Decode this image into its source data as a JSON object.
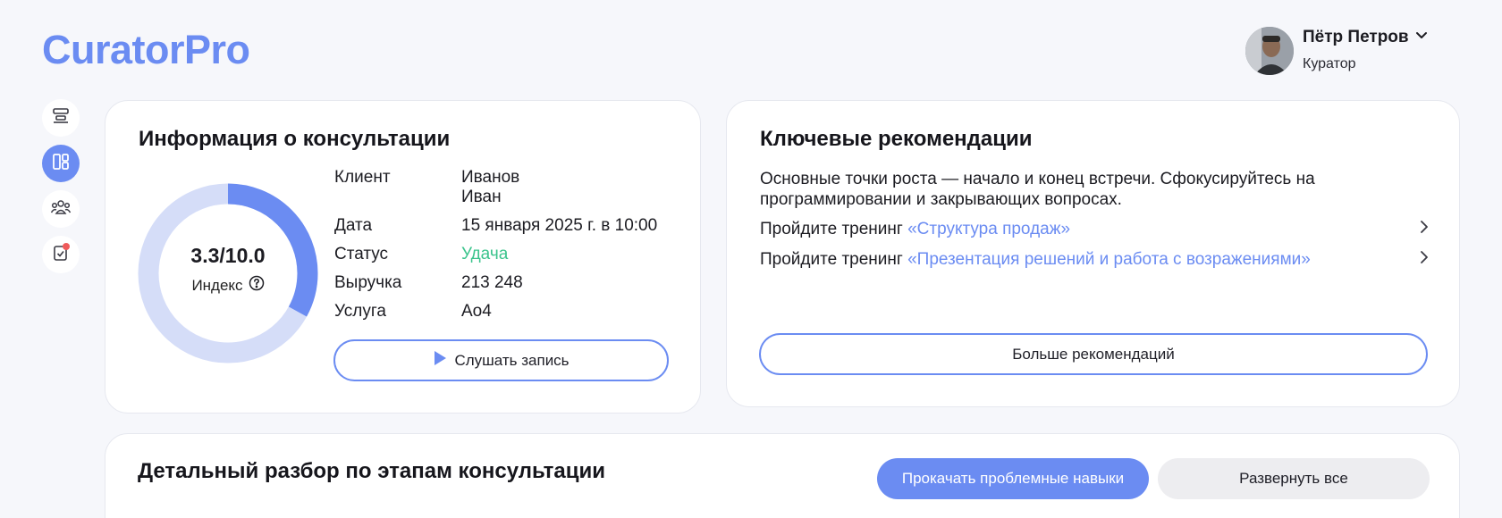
{
  "app": {
    "title": "CuratorPro",
    "brand_color": "#6b8cf2"
  },
  "user": {
    "name": "Пётр Петров",
    "role": "Куратор",
    "avatar": "avatar-photo"
  },
  "sidenav": [
    {
      "icon": "stages-icon",
      "active": false
    },
    {
      "icon": "dashboard-icon",
      "active": true
    },
    {
      "icon": "team-icon",
      "active": false
    },
    {
      "icon": "tasks-icon",
      "active": false,
      "badge": true
    }
  ],
  "consultation": {
    "title": "Информация о консультации",
    "score": {
      "value": 3.3,
      "max": 10.0,
      "display": "3.3/10.0",
      "label": "Индекс"
    },
    "fields": [
      {
        "key": "Клиент",
        "value_line1": "Иванов",
        "value_line2": "Иван"
      },
      {
        "key": "Дата",
        "value": "15 января 2025 г. в 10:00"
      },
      {
        "key": "Статус",
        "value": "Удача"
      },
      {
        "key": "Выручка",
        "value": "213 248"
      },
      {
        "key": "Услуга",
        "value": "Ao4"
      }
    ],
    "listen_button": "Слушать запись"
  },
  "recommendations": {
    "title": "Ключевые рекомендации",
    "summary": "Основные точки роста — начало и конец встречи. Сфокусируйтесь на программировании и закрывающих вопросах.",
    "items": [
      {
        "prefix": "Пройдите тренинг ",
        "link": "«Структура продаж»"
      },
      {
        "prefix": "Пройдите тренинг ",
        "link": "«Презентация решений и работа с возражениями»"
      }
    ],
    "more_button": "Больше рекомендаций"
  },
  "detail": {
    "title": "Детальный разбор по этапам консультации",
    "pump_button": "Прокачать проблемные навыки",
    "expand_button": "Развернуть все"
  }
}
